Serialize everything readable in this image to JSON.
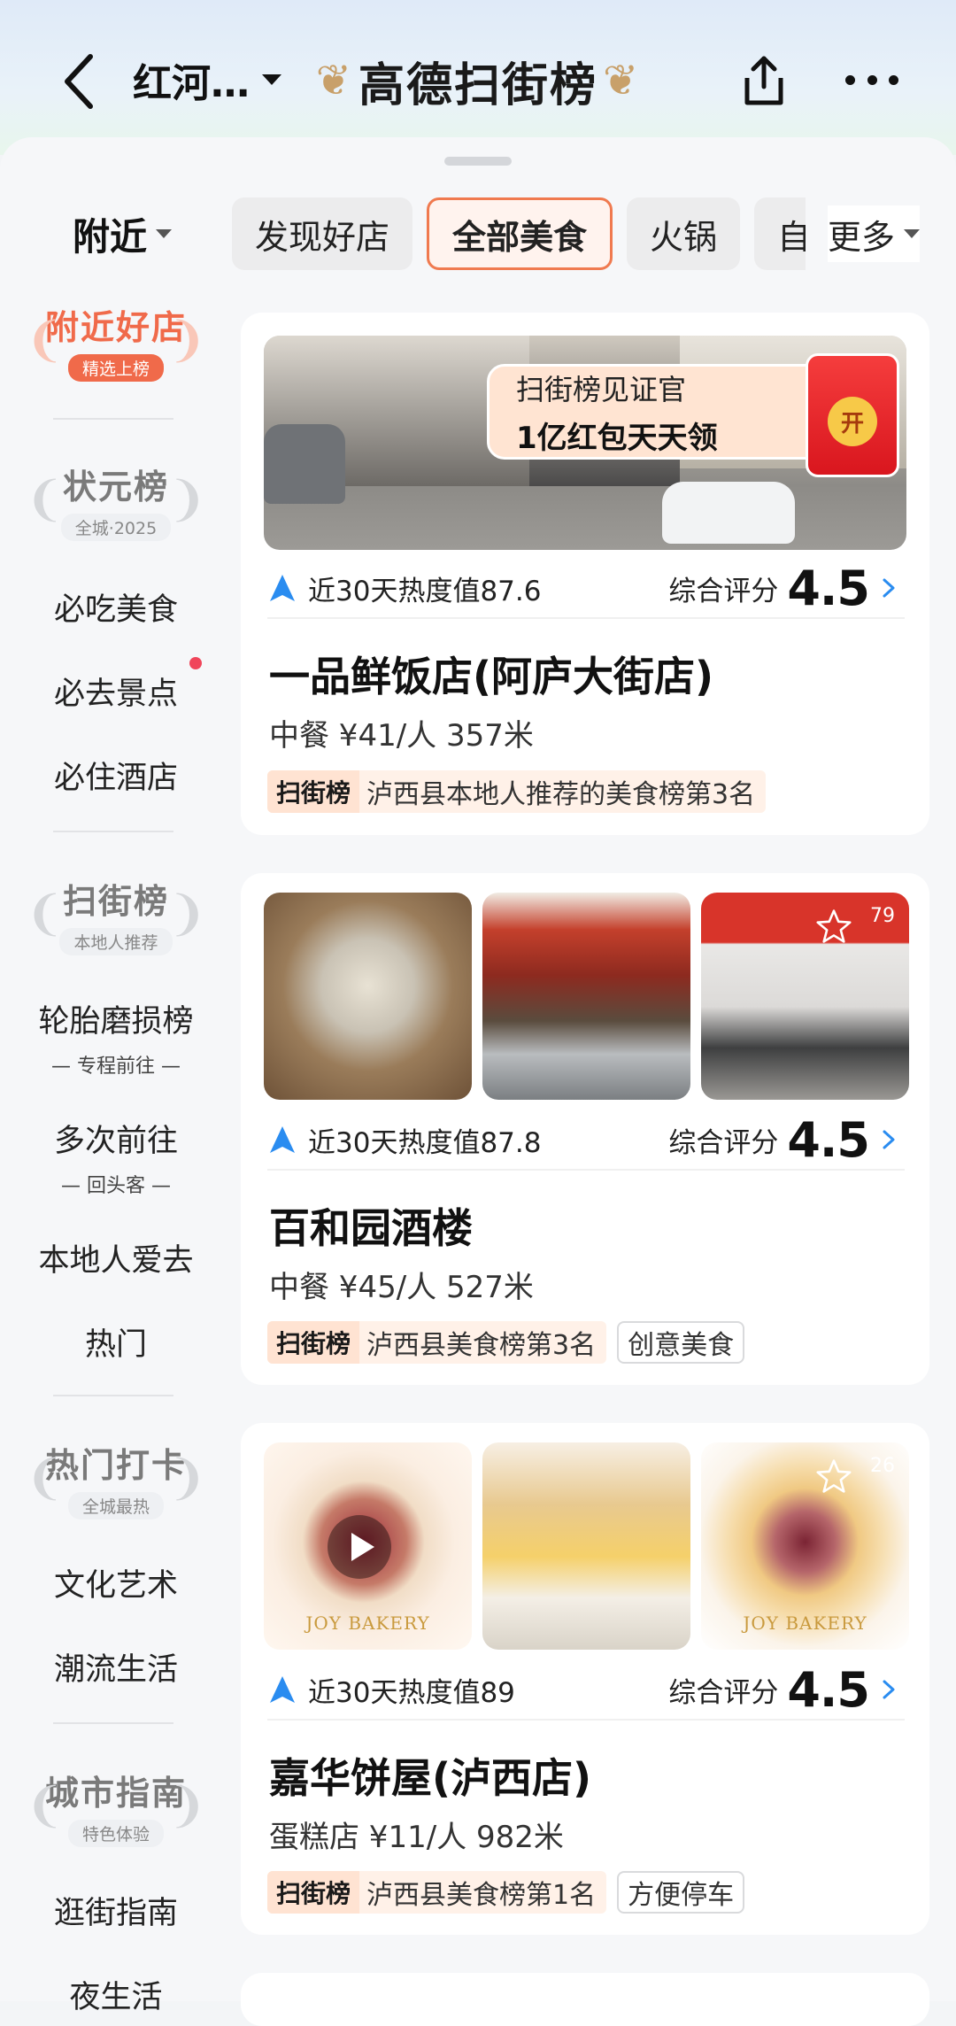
{
  "header": {
    "city": "红河…",
    "brand": "高德扫街榜"
  },
  "filters": {
    "nearby": "附近",
    "chips": [
      {
        "label": "发现好店",
        "active": false
      },
      {
        "label": "全部美食",
        "active": true
      },
      {
        "label": "火锅",
        "active": false
      },
      {
        "label": "自",
        "active": false
      }
    ],
    "more": "更多"
  },
  "sidebar": {
    "sections": [
      {
        "title": "附近好店",
        "sub": "精选上榜",
        "items": []
      },
      {
        "title": "状元榜",
        "sub": "全城·2025",
        "items": [
          {
            "label": "必吃美食"
          },
          {
            "label": "必去景点",
            "dot": true
          },
          {
            "label": "必住酒店"
          }
        ]
      },
      {
        "title": "扫街榜",
        "sub": "本地人推荐",
        "items": [
          {
            "label": "轮胎磨损榜",
            "sub": "— 专程前往 —"
          },
          {
            "label": "多次前往",
            "sub": "— 回头客 —"
          },
          {
            "label": "本地人爱去"
          },
          {
            "label": "热门"
          }
        ]
      },
      {
        "title": "热门打卡",
        "sub": "全城最热",
        "items": [
          {
            "label": "文化艺术"
          },
          {
            "label": "潮流生活"
          }
        ]
      },
      {
        "title": "城市指南",
        "sub": "特色体验",
        "items": [
          {
            "label": "逛街指南"
          },
          {
            "label": "夜生活"
          }
        ]
      }
    ]
  },
  "cards": [
    {
      "promo_line1": "扫街榜见证官",
      "promo_line2": "1亿红包天天领",
      "redpack_label": "开",
      "heat": "近30天热度值87.6",
      "score_label": "综合评分",
      "score": "4.5",
      "name": "一品鲜饭店(阿庐大街店)",
      "info": "中餐 ¥41/人 357米",
      "rank_logo": "扫街榜",
      "rank_text": "泸西县本地人推荐的美食榜第3名",
      "tags": []
    },
    {
      "photo_count": "79",
      "heat": "近30天热度值87.8",
      "score_label": "综合评分",
      "score": "4.5",
      "name": "百和园酒楼",
      "info": "中餐 ¥45/人 527米",
      "rank_logo": "扫街榜",
      "rank_text": "泸西县美食榜第3名",
      "tags": [
        "创意美食"
      ]
    },
    {
      "photo_count": "26",
      "watermark": "JOY BAKERY",
      "heat": "近30天热度值89",
      "score_label": "综合评分",
      "score": "4.5",
      "name": "嘉华饼屋(泸西店)",
      "info": "蛋糕店 ¥11/人 982米",
      "rank_logo": "扫街榜",
      "rank_text": "泸西县美食榜第1名",
      "tags": [
        "方便停车"
      ]
    }
  ],
  "colors": {
    "accent": "#f07a4f",
    "badge_red": "#f06a4a",
    "nav_blue": "#2a8cf0"
  }
}
